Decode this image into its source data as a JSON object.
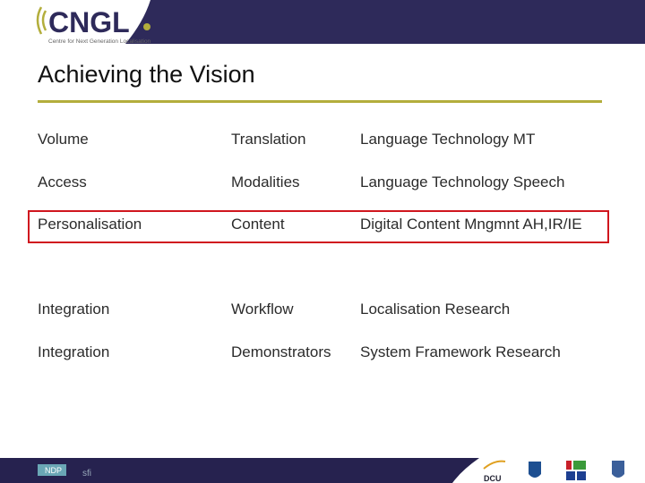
{
  "header": {
    "logo_text": "CNGL",
    "logo_tagline": "Centre for Next Generation Localisation"
  },
  "title": "Achieving the Vision",
  "rows": [
    [
      "Volume",
      "Translation",
      "Language Technology MT"
    ],
    [
      "Access",
      "Modalities",
      "Language Technology Speech"
    ],
    [
      "Personalisation",
      "Content",
      "Digital Content Mngmnt AH,IR/IE"
    ],
    [
      "Integration",
      "Workflow",
      "Localisation Research"
    ],
    [
      "Integration",
      "Demonstrators",
      "System Framework Research"
    ]
  ],
  "highlighted_row": 2,
  "footer": {
    "logos": [
      "NDP",
      "sfi",
      "DCU",
      "UCD",
      "TCD",
      "UL"
    ]
  },
  "colors": {
    "navy": "#2e2a5a",
    "olive": "#b3ae3c",
    "highlight": "#d0161e"
  }
}
